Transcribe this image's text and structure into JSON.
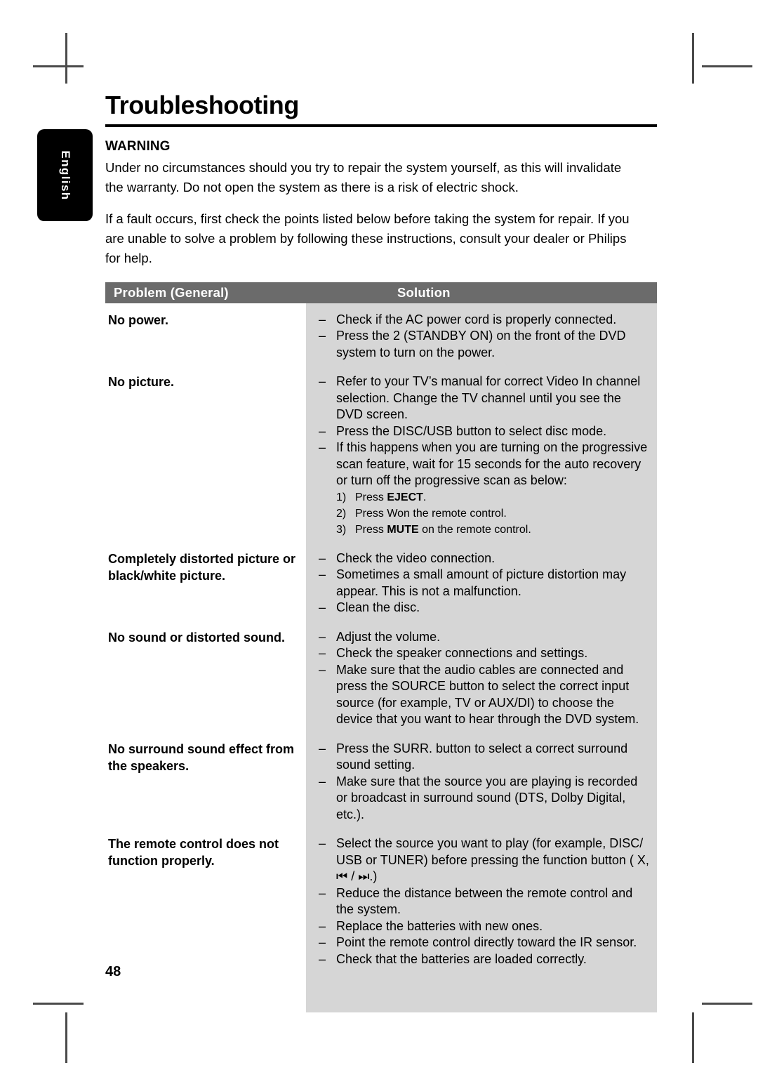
{
  "page": {
    "title": "Troubleshooting",
    "number": "48",
    "language_tab": "English"
  },
  "warning": {
    "heading": "WARNING",
    "paragraph1": "Under no circumstances should you try to repair the system yourself, as this will invalidate the warranty. Do not open the system as there is a risk of electric shock.",
    "paragraph2": "If a fault occurs, first check the points listed below before taking the system for repair. If you are unable to solve a problem by following these instructions, consult your dealer or Philips for help."
  },
  "table": {
    "headers": {
      "problem": "Problem (General)",
      "solution": "Solution"
    },
    "rows": [
      {
        "problem": "No power.",
        "solutions": [
          "Check if the AC power cord is properly connected.",
          "Press the 2  (STANDBY ON) on the front of the DVD system to turn on the power."
        ],
        "substeps": []
      },
      {
        "problem": "No picture.",
        "solutions": [
          "Refer to your TV’s manual for correct Video In channel selection. Change the TV channel until you see the DVD screen.",
          "Press the DISC/USB button to select disc mode.",
          "If this happens when you are turning on the progressive scan feature, wait for 15 seconds for the auto recovery or turn off the progressive scan as below:"
        ],
        "substeps": [
          {
            "num": "1)",
            "pre": "Press ",
            "bold": "EJECT",
            "post": "."
          },
          {
            "num": "2)",
            "pre": "Press  Won the remote control.",
            "bold": "",
            "post": ""
          },
          {
            "num": "3)",
            "pre": "Press ",
            "bold": "MUTE",
            "post": " on the remote control."
          }
        ]
      },
      {
        "problem": "Completely distorted picture or black/white picture.",
        "solutions": [
          "Check the video connection.",
          "Sometimes a small amount of picture distortion may appear. This is not a malfunction.",
          "Clean the disc."
        ],
        "substeps": []
      },
      {
        "problem": "No sound or distorted sound.",
        "solutions": [
          "Adjust the volume.",
          "Check the speaker connections and settings.",
          "Make sure that the audio cables are connected and press the SOURCE button to select the correct input source (for example, TV or AUX/DI) to choose the device that you want to hear through the DVD system."
        ],
        "substeps": []
      },
      {
        "problem": "No surround sound effect from the speakers.",
        "solutions": [
          "Press the SURR. button to select a correct surround sound setting.",
          "Make sure that the source you are playing is recorded or broadcast in surround sound (DTS, Dolby Digital, etc.)."
        ],
        "substeps": []
      },
      {
        "problem": "The remote control does not function properly.",
        "solutions": [
          "Select the source you want to play (for example, DISC/ USB or TUNER) before pressing the function button ( X, ⏮ / ⏭.)",
          "Reduce the distance between the remote control and the system.",
          "Replace the batteries with new ones.",
          "Point the remote control directly toward the IR sensor.",
          "Check that the batteries are loaded correctly."
        ],
        "substeps": []
      }
    ]
  },
  "colors": {
    "header_band": "#6b6b6b",
    "solution_column": "#d6d6d6",
    "tab_background": "#000000",
    "text": "#000000"
  }
}
